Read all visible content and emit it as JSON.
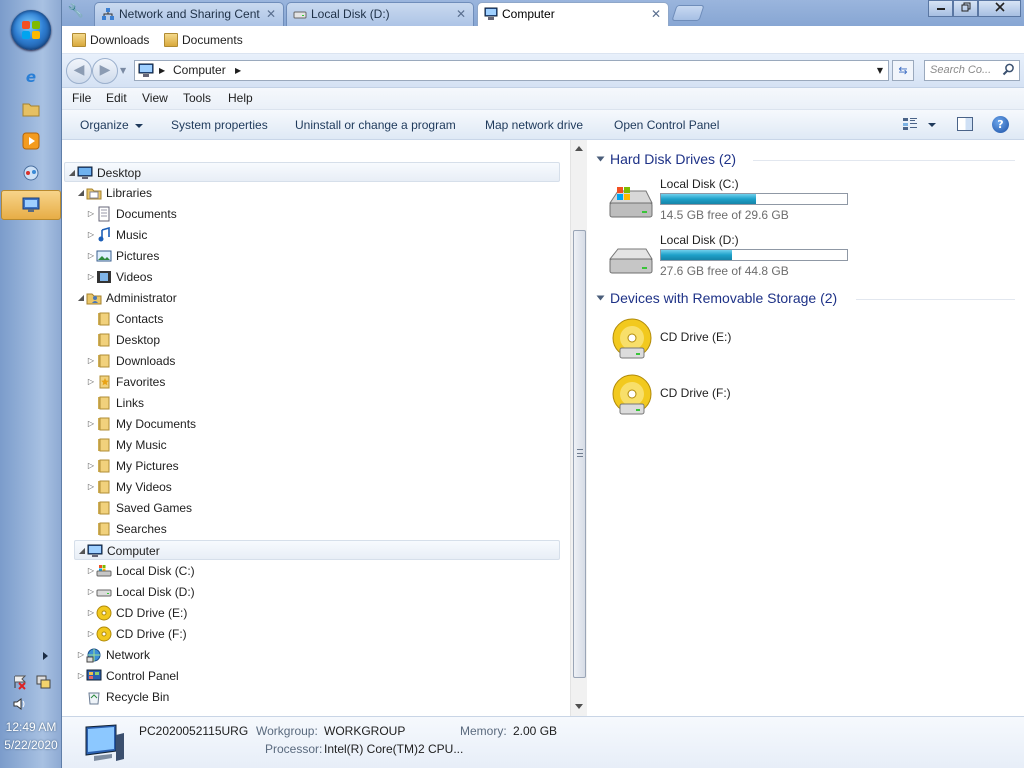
{
  "taskbar": {
    "clock_time": "12:49 AM",
    "clock_date": "5/22/2020"
  },
  "tabs": [
    {
      "label": "Network and Sharing Cent",
      "icon": "network-center-icon"
    },
    {
      "label": "Local Disk (D:)",
      "icon": "drive-icon"
    },
    {
      "label": "Computer",
      "icon": "computer-icon"
    }
  ],
  "favorites": [
    {
      "label": "Downloads"
    },
    {
      "label": "Documents"
    }
  ],
  "address": {
    "path": "Computer",
    "search_placeholder": "Search Co..."
  },
  "menu": [
    "File",
    "Edit",
    "View",
    "Tools",
    "Help"
  ],
  "commands": {
    "organize": "Organize",
    "system_properties": "System properties",
    "uninstall": "Uninstall or change a program",
    "map_drive": "Map network drive",
    "control_panel": "Open Control Panel",
    "help": "?"
  },
  "tree": [
    {
      "label": "Desktop",
      "level": 0,
      "icon": "desktop-icon",
      "expanded": true
    },
    {
      "label": "Libraries",
      "level": 1,
      "icon": "libraries-icon",
      "expanded": true
    },
    {
      "label": "Documents",
      "level": 2,
      "icon": "documents-icon"
    },
    {
      "label": "Music",
      "level": 2,
      "icon": "music-icon"
    },
    {
      "label": "Pictures",
      "level": 2,
      "icon": "pictures-icon"
    },
    {
      "label": "Videos",
      "level": 2,
      "icon": "videos-icon"
    },
    {
      "label": "Administrator",
      "level": 1,
      "icon": "user-folder-icon",
      "expanded": true
    },
    {
      "label": "Contacts",
      "level": 2,
      "icon": "folder-icon"
    },
    {
      "label": "Desktop",
      "level": 2,
      "icon": "folder-icon"
    },
    {
      "label": "Downloads",
      "level": 2,
      "icon": "folder-icon"
    },
    {
      "label": "Favorites",
      "level": 2,
      "icon": "favorites-folder-icon"
    },
    {
      "label": "Links",
      "level": 2,
      "icon": "folder-icon"
    },
    {
      "label": "My Documents",
      "level": 2,
      "icon": "folder-icon"
    },
    {
      "label": "My Music",
      "level": 2,
      "icon": "folder-icon"
    },
    {
      "label": "My Pictures",
      "level": 2,
      "icon": "folder-icon"
    },
    {
      "label": "My Videos",
      "level": 2,
      "icon": "folder-icon"
    },
    {
      "label": "Saved Games",
      "level": 2,
      "icon": "folder-icon"
    },
    {
      "label": "Searches",
      "level": 2,
      "icon": "folder-icon"
    },
    {
      "label": "Computer",
      "level": 1,
      "icon": "computer-icon",
      "expanded": true
    },
    {
      "label": "Local Disk (C:)",
      "level": 2,
      "icon": "drive-c-icon"
    },
    {
      "label": "Local Disk (D:)",
      "level": 2,
      "icon": "drive-d-icon"
    },
    {
      "label": "CD Drive (E:)",
      "level": 2,
      "icon": "cd-drive-icon"
    },
    {
      "label": "CD Drive (F:)",
      "level": 2,
      "icon": "cd-drive-icon"
    },
    {
      "label": "Network",
      "level": 1,
      "icon": "network-icon"
    },
    {
      "label": "Control Panel",
      "level": 1,
      "icon": "control-panel-icon"
    },
    {
      "label": "Recycle Bin",
      "level": 1,
      "icon": "recycle-bin-icon"
    }
  ],
  "content": {
    "hard_disk_header": "Hard Disk Drives (2)",
    "drives": [
      {
        "name": "Local Disk (C:)",
        "free": "14.5 GB free of 29.6 GB",
        "used_fraction": 0.51
      },
      {
        "name": "Local Disk (D:)",
        "free": "27.6 GB free of 44.8 GB",
        "used_fraction": 0.38
      }
    ],
    "removable_header": "Devices with Removable Storage (2)",
    "removable": [
      {
        "name": "CD Drive (E:)"
      },
      {
        "name": "CD Drive (F:)"
      }
    ]
  },
  "details": {
    "computer_name": "PC2020052115URG",
    "workgroup_label": "Workgroup:",
    "workgroup": "WORKGROUP",
    "memory_label": "Memory:",
    "memory": "2.00 GB",
    "processor_label": "Processor:",
    "processor": "Intel(R) Core(TM)2 CPU..."
  },
  "colors": {
    "group_header": "#1e3287",
    "drive_bar": "#1ea1c9",
    "taskbar": "#a8c1e2"
  }
}
